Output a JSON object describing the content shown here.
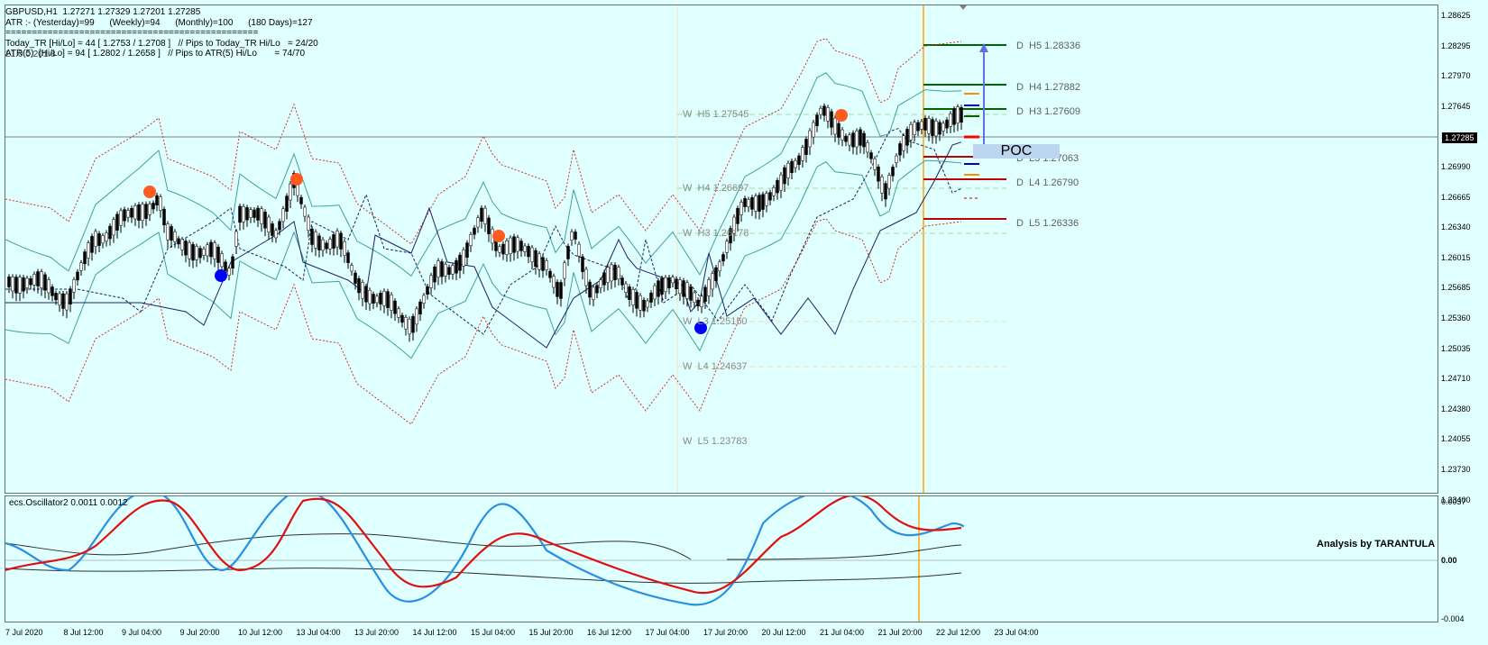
{
  "header": {
    "symbol_line": "GBPUSD,H1  1.27271 1.27329 1.27201 1.27285",
    "atr_line": "ATR :- (Yesterday)=99      (Weekly)=94      (Monthly)=100      (180 Days)=127",
    "separator": "================================================",
    "today_line": "Today_TR [Hi/Lo] = 44 [ 1.2753 / 1.2708 ]   // Pips to Today_TR Hi/Lo   = 24/20",
    "atr5_line": "ATR(5)  [Hi/Lo] = 94 [ 1.2802 / 1.2658 ]   // Pips to ATR(5) Hi/Lo       = 74/70",
    "overlay_text": "21.0.0.201.8"
  },
  "price_axis": [
    "1.28625",
    "1.28295",
    "1.27970",
    "1.27645",
    "1.27320",
    "1.26990",
    "1.26665",
    "1.26340",
    "1.26015",
    "1.25685",
    "1.25360",
    "1.25035",
    "1.24710",
    "1.24380",
    "1.24055",
    "1.23730",
    "1.23400"
  ],
  "current_price": "1.27285",
  "time_axis": [
    "7 Jul 2020",
    "8 Jul 12:00",
    "9 Jul 04:00",
    "9 Jul 20:00",
    "10 Jul 12:00",
    "13 Jul 04:00",
    "13 Jul 20:00",
    "14 Jul 12:00",
    "15 Jul 04:00",
    "15 Jul 20:00",
    "16 Jul 12:00",
    "17 Jul 04:00",
    "17 Jul 20:00",
    "20 Jul 12:00",
    "21 Jul 04:00",
    "21 Jul 20:00",
    "22 Jul 12:00",
    "23 Jul 04:00"
  ],
  "weekly_levels": {
    "h5": "W  H5 1.27545",
    "h4": "W  H4 1.26697",
    "h3": "W  H3 1.26178",
    "l3": "W  L3 1.25150",
    "l4": "W  L4 1.24637",
    "l5": "W  L5 1.23783"
  },
  "daily_levels": {
    "h5": "D  H5 1.28336",
    "h4": "D  H4 1.27882",
    "h3": "D  H3 1.27609",
    "l3": "D  L3 1.27063",
    "l4": "D  L4 1.26790",
    "l5": "D  L5 1.26336"
  },
  "poc_label": "POC",
  "oscillator": {
    "title": "ecs.Oscillator2 0.0011 0.0012",
    "axis": [
      "0.0037",
      "0.00",
      "-0.004"
    ],
    "watermark": "Analysis by TARANTULA"
  },
  "colors": {
    "background": "#e0ffff",
    "bollinger": "#3fa0a0",
    "envelope": "#d03030",
    "signal_up": "#1b7dff",
    "signal_down": "#ff5a1f",
    "osc_blue": "#2a8fe0",
    "osc_red": "#e01010",
    "session_line": "#ffa500"
  }
}
